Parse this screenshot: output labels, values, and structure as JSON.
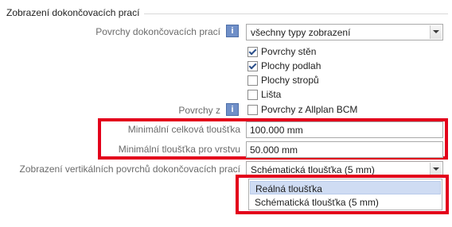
{
  "section": {
    "title": "Zobrazení dokončovacích prací"
  },
  "surfaces": {
    "label": "Povrchy dokončovacích prací",
    "info_icon": "i",
    "selected": "všechny typy zobrazení"
  },
  "checkboxes": [
    {
      "label": "Povrchy stěn",
      "checked": true
    },
    {
      "label": "Plochy podlah",
      "checked": true
    },
    {
      "label": "Plochy stropů",
      "checked": false
    },
    {
      "label": "Lišta",
      "checked": false
    }
  ],
  "surfaces_from": {
    "label": "Povrchy z",
    "info_icon": "i",
    "checkbox_label": "Povrchy z Allplan BCM",
    "checked": false
  },
  "min_total_thickness": {
    "label": "Minimální celková tloušťka",
    "value": "100.000 mm"
  },
  "min_layer_thickness": {
    "label": "Minimální tloušťka pro vrstvu",
    "value": "50.000 mm"
  },
  "vertical_display": {
    "label": "Zobrazení vertikálních povrchů dokončovacích prací",
    "selected": "Schématická tloušťka (5 mm)",
    "options": [
      "Reálná tloušťka",
      "Schématická tloušťka (5 mm)"
    ],
    "highlighted_option": "Reálná tloušťka"
  },
  "colors": {
    "highlight_box": "#e3001b",
    "info_icon": "#6f8fc8",
    "hover_item": "#cfdcf3"
  }
}
